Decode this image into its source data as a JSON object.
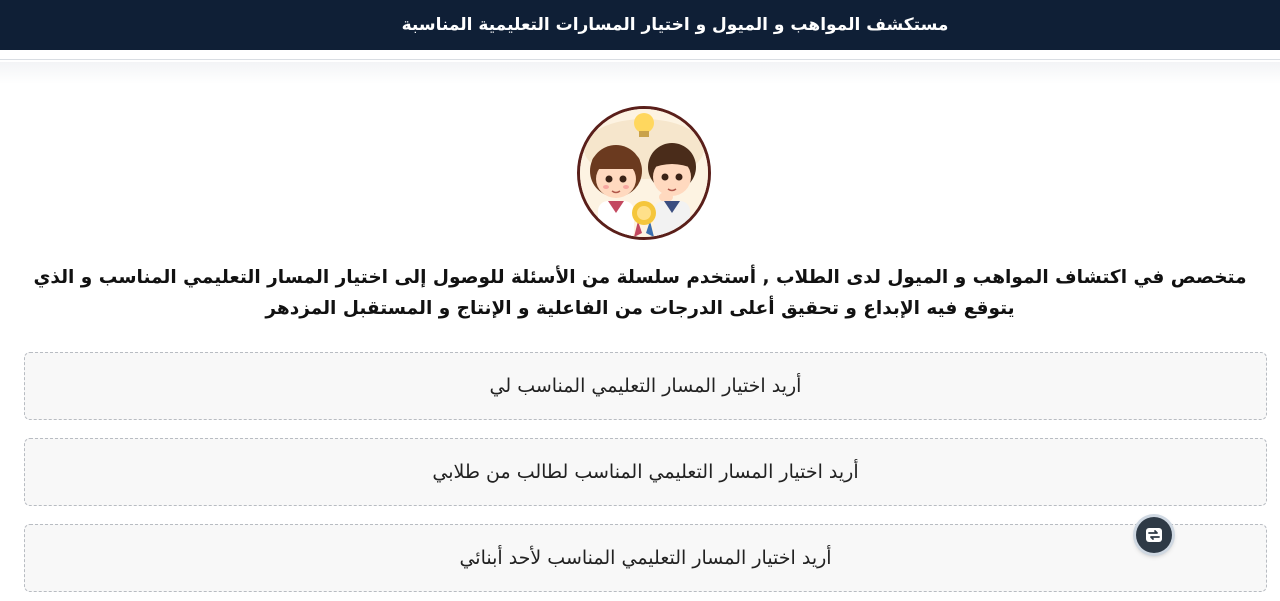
{
  "header": {
    "title": "مستكشف المواهب و الميول و اختيار المسارات التعليمية المناسبة"
  },
  "avatar": {
    "icon": "two-children-lightbulb-medal-illustration"
  },
  "intro": {
    "text": "متخصص في اكتشاف المواهب و الميول لدى الطلاب , أستخدم سلسلة من الأسئلة للوصول إلى اختيار المسار التعليمي المناسب و الذي يتوقع فيه الإبداع و تحقيق أعلى الدرجات من الفاعلية و الإنتاج و المستقبل المزدهر"
  },
  "options": [
    {
      "label": "أريد اختيار المسار التعليمي المناسب لي"
    },
    {
      "label": "أريد اختيار المسار التعليمي المناسب لطالب من طلابي"
    },
    {
      "label": "أريد اختيار المسار التعليمي المناسب لأحد أبنائي"
    }
  ],
  "floating_button": {
    "icon": "chat-switch-icon"
  },
  "colors": {
    "header_bg": "#0f1f36",
    "header_text": "#ffffff",
    "option_border": "#b8bcc2",
    "option_bg": "#f8f8f8",
    "avatar_border": "#5a1f1a"
  }
}
